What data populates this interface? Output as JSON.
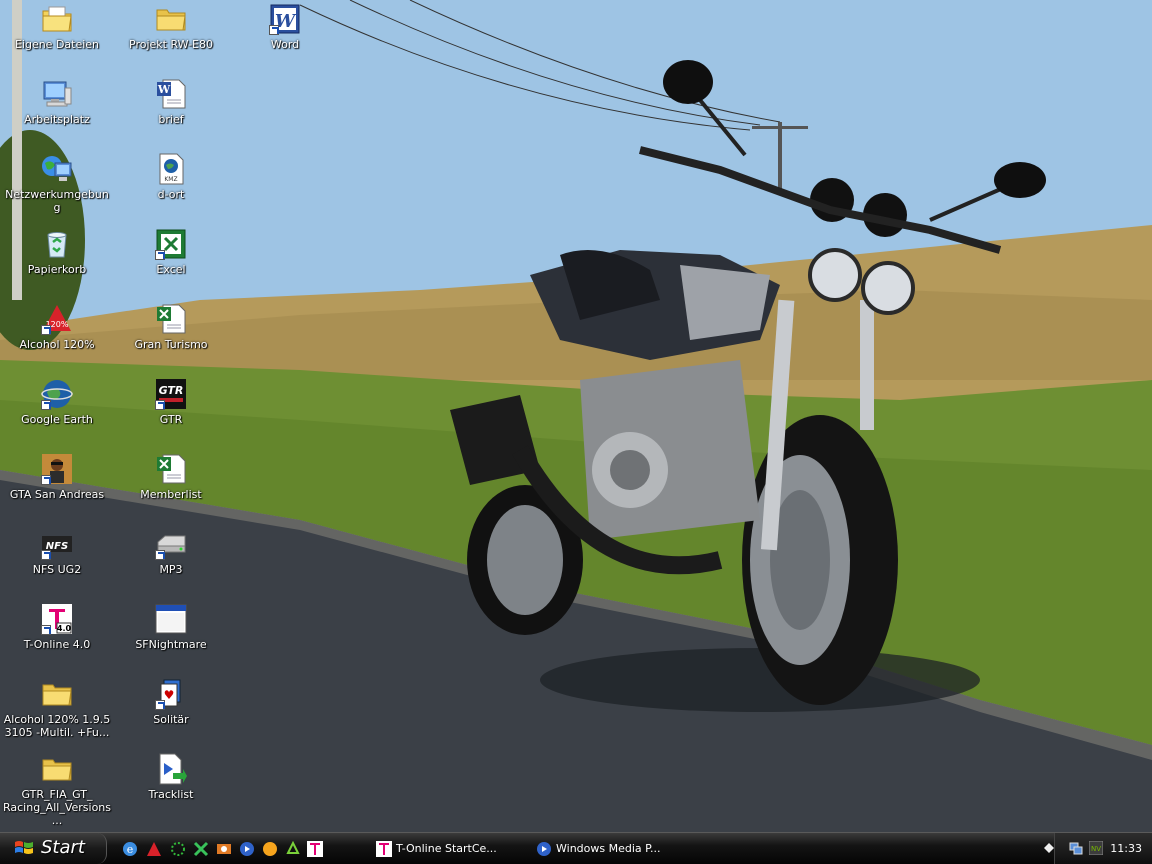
{
  "desktop": {
    "icons": [
      {
        "label": "Eigene Dateien",
        "icon": "my-documents-folder-icon"
      },
      {
        "label": "Arbeitsplatz",
        "icon": "my-computer-icon"
      },
      {
        "label": "Netzwerkumgebung",
        "icon": "network-places-icon"
      },
      {
        "label": "Papierkorb",
        "icon": "recycle-bin-icon"
      },
      {
        "label": "Alcohol 120%",
        "icon": "alcohol-120-icon"
      },
      {
        "label": "Google Earth",
        "icon": "google-earth-icon"
      },
      {
        "label": "GTA San Andreas",
        "icon": "gta-san-andreas-icon"
      },
      {
        "label": "NFS UG2",
        "icon": "nfs-ug2-icon"
      },
      {
        "label": "T-Online 4.0",
        "icon": "t-online-icon"
      },
      {
        "label": "Alcohol 120% 1.9.5 3105 -Multil. +Fu...",
        "icon": "folder-icon"
      },
      {
        "label": "GTR_FIA_GT_ Racing_All_Versions...",
        "icon": "folder-icon"
      },
      {
        "label": "Projekt RW-E80",
        "icon": "folder-icon"
      },
      {
        "label": "brief",
        "icon": "word-document-icon"
      },
      {
        "label": "d-ort",
        "icon": "kmz-file-icon"
      },
      {
        "label": "Excel",
        "icon": "excel-icon"
      },
      {
        "label": "Gran Turismo",
        "icon": "excel-document-icon"
      },
      {
        "label": "GTR",
        "icon": "gtr-game-icon"
      },
      {
        "label": "Memberlist",
        "icon": "excel-document-icon"
      },
      {
        "label": "MP3",
        "icon": "drive-shortcut-icon"
      },
      {
        "label": "SFNightmare",
        "icon": "window-app-icon"
      },
      {
        "label": "Solitär",
        "icon": "solitaire-icon"
      },
      {
        "label": "Tracklist",
        "icon": "playlist-file-icon"
      },
      {
        "label": "Word",
        "icon": "word-icon"
      }
    ]
  },
  "taskbar": {
    "start_label": "Start",
    "quick_launch": [
      "ie-icon",
      "alcohol-icon",
      "green-spark-icon",
      "xfire-icon",
      "media-icon",
      "media-player-icon",
      "orange-ball-icon",
      "recycle-arrows-icon",
      "t-online-icon"
    ],
    "tasks": [
      {
        "label": "T-Online StartCe...",
        "icon": "t-online-icon"
      },
      {
        "label": "Windows Media P...",
        "icon": "windows-media-player-icon"
      }
    ],
    "tray": {
      "clock": "11:33",
      "icons": [
        "network-icon",
        "nvidia-icon"
      ]
    }
  },
  "colors": {
    "sky": "#9cc3e4",
    "grass": "#7f9a3a",
    "road": "#3c4148",
    "taskbar": "#0f0f0f"
  }
}
